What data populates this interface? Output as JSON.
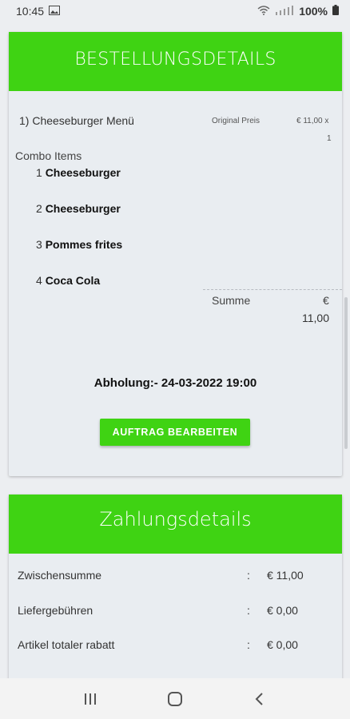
{
  "status": {
    "time": "10:45",
    "battery": "100%"
  },
  "order": {
    "banner_title": "BESTELLUNGSDETAILS",
    "item_title": "1) Cheeseburger Menü",
    "original_price_label": "Original Preis",
    "price": "€ 11,00 x",
    "quantity": "1",
    "combo_label": "Combo Items",
    "combo_items": [
      {
        "num": "1",
        "name": "Cheeseburger"
      },
      {
        "num": "2",
        "name": "Cheeseburger"
      },
      {
        "num": "3",
        "name": "Pommes frites"
      },
      {
        "num": "4",
        "name": "Coca Cola"
      }
    ],
    "sum_label": "Summe",
    "sum_currency": "€",
    "sum_value": "11,00",
    "pickup_text": "Abholung:- 24-03-2022 19:00",
    "edit_button": "AUFTRAG BEARBEITEN"
  },
  "payment": {
    "banner_title": "Zahlungsdetails",
    "rows": [
      {
        "label": "Zwischensumme",
        "sep": ":",
        "value": "€ 11,00"
      },
      {
        "label": "Liefergebühren",
        "sep": ":",
        "value": "€ 0,00"
      },
      {
        "label": "Artikel totaler rabatt",
        "sep": ":",
        "value": "€ 0,00"
      }
    ]
  },
  "colors": {
    "accent": "#3fd313",
    "background": "#eceef1",
    "card": "#e9edf1"
  }
}
